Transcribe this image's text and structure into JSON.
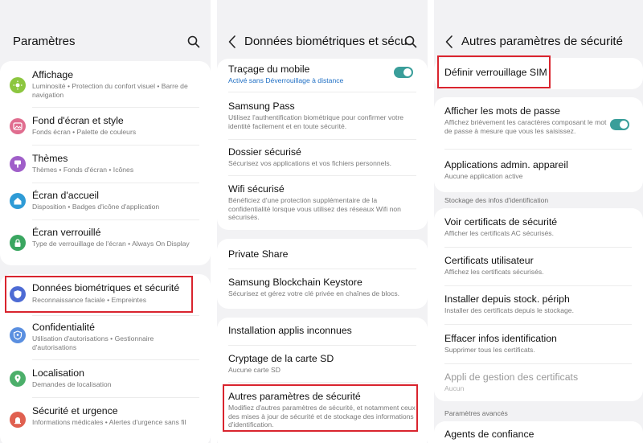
{
  "screen1": {
    "title": "Paramètres",
    "items": [
      {
        "label": "Affichage",
        "sub": "Luminosité • Protection du confort visuel • Barre de navigation",
        "icon": "sun-icon",
        "color": "#8cc63f"
      },
      {
        "label": "Fond d'écran et style",
        "sub": "Fonds écran • Palette de couleurs",
        "icon": "picture-icon",
        "color": "#e06d8f"
      },
      {
        "label": "Thèmes",
        "sub": "Thèmes • Fonds d'écran • Icônes",
        "icon": "theme-brush-icon",
        "color": "#a05fc9"
      },
      {
        "label": "Écran d'accueil",
        "sub": "Disposition • Badges d'icône d'application",
        "icon": "home-icon",
        "color": "#2e9bd6"
      },
      {
        "label": "Écran verrouillé",
        "sub": "Type de verrouillage de l'écran • Always On Display",
        "icon": "lock-icon",
        "color": "#3aa660"
      },
      {
        "label": "Données biométriques et sécurité",
        "sub": "Reconnaissance faciale • Empreintes",
        "icon": "shield-icon",
        "color": "#4d6bd4"
      },
      {
        "label": "Confidentialité",
        "sub": "Utilisation d'autorisations • Gestionnaire d'autorisations",
        "icon": "privacy-shield-icon",
        "color": "#5a8fe0"
      },
      {
        "label": "Localisation",
        "sub": "Demandes de localisation",
        "icon": "location-pin-icon",
        "color": "#4caf6a"
      },
      {
        "label": "Sécurité et urgence",
        "sub": "Informations médicales • Alertes d'urgence sans fil",
        "icon": "emergency-icon",
        "color": "#e06050"
      }
    ]
  },
  "screen2": {
    "title": "Données biométriques et sécu",
    "items": [
      {
        "label": "Traçage du mobile",
        "sub": "Activé sans Déverrouillage à distance"
      },
      {
        "label": "Samsung Pass",
        "sub": "Utilisez l'authentification biométrique pour confirmer votre identité facilement et en toute sécurité."
      },
      {
        "label": "Dossier sécurisé",
        "sub": "Sécurisez vos applications et vos fichiers personnels."
      },
      {
        "label": "Wifi sécurisé",
        "sub": "Bénéficiez d'une protection supplémentaire de la confidentialité lorsque vous utilisez des réseaux Wifi non sécurisés."
      },
      {
        "label": "Private Share",
        "sub": ""
      },
      {
        "label": "Samsung Blockchain Keystore",
        "sub": "Sécurisez et gérez votre clé privée en chaînes de blocs."
      },
      {
        "label": "Installation applis inconnues",
        "sub": ""
      },
      {
        "label": "Cryptage de la carte SD",
        "sub": "Aucune carte SD"
      },
      {
        "label": "Autres paramètres de sécurité",
        "sub": "Modifiez d'autres paramètres de sécurité, et notamment ceux des mises à jour de sécurité et de stockage des informations d'identification."
      }
    ]
  },
  "screen3": {
    "title": "Autres paramètres de sécurité",
    "items": [
      {
        "label": "Définir verrouillage SIM",
        "sub": ""
      },
      {
        "label": "Afficher les mots de passe",
        "sub": "Affichez brièvement les caractères composant le mot de passe à mesure que vous les saisissez."
      },
      {
        "label": "Applications admin. appareil",
        "sub": "Aucune application active"
      },
      {
        "label": "Voir certificats de sécurité",
        "sub": "Afficher les certificats AC sécurisés."
      },
      {
        "label": "Certificats utilisateur",
        "sub": "Affichez les certificats sécurisés."
      },
      {
        "label": "Installer depuis stock. périph",
        "sub": "Installer des certificats depuis le stockage."
      },
      {
        "label": "Effacer infos identification",
        "sub": "Supprimer tous les certificats."
      },
      {
        "label": "Appli de gestion des certificats",
        "sub": "Aucun"
      },
      {
        "label": "Agents de confiance",
        "sub": ""
      }
    ],
    "sections": {
      "storage": "Stockage des infos d'identification",
      "advanced": "Paramètres avancés"
    }
  },
  "colors": {
    "toggle": "#3a9e9a",
    "highlight": "#d9242e",
    "accent_text": "#1f6fc4"
  }
}
